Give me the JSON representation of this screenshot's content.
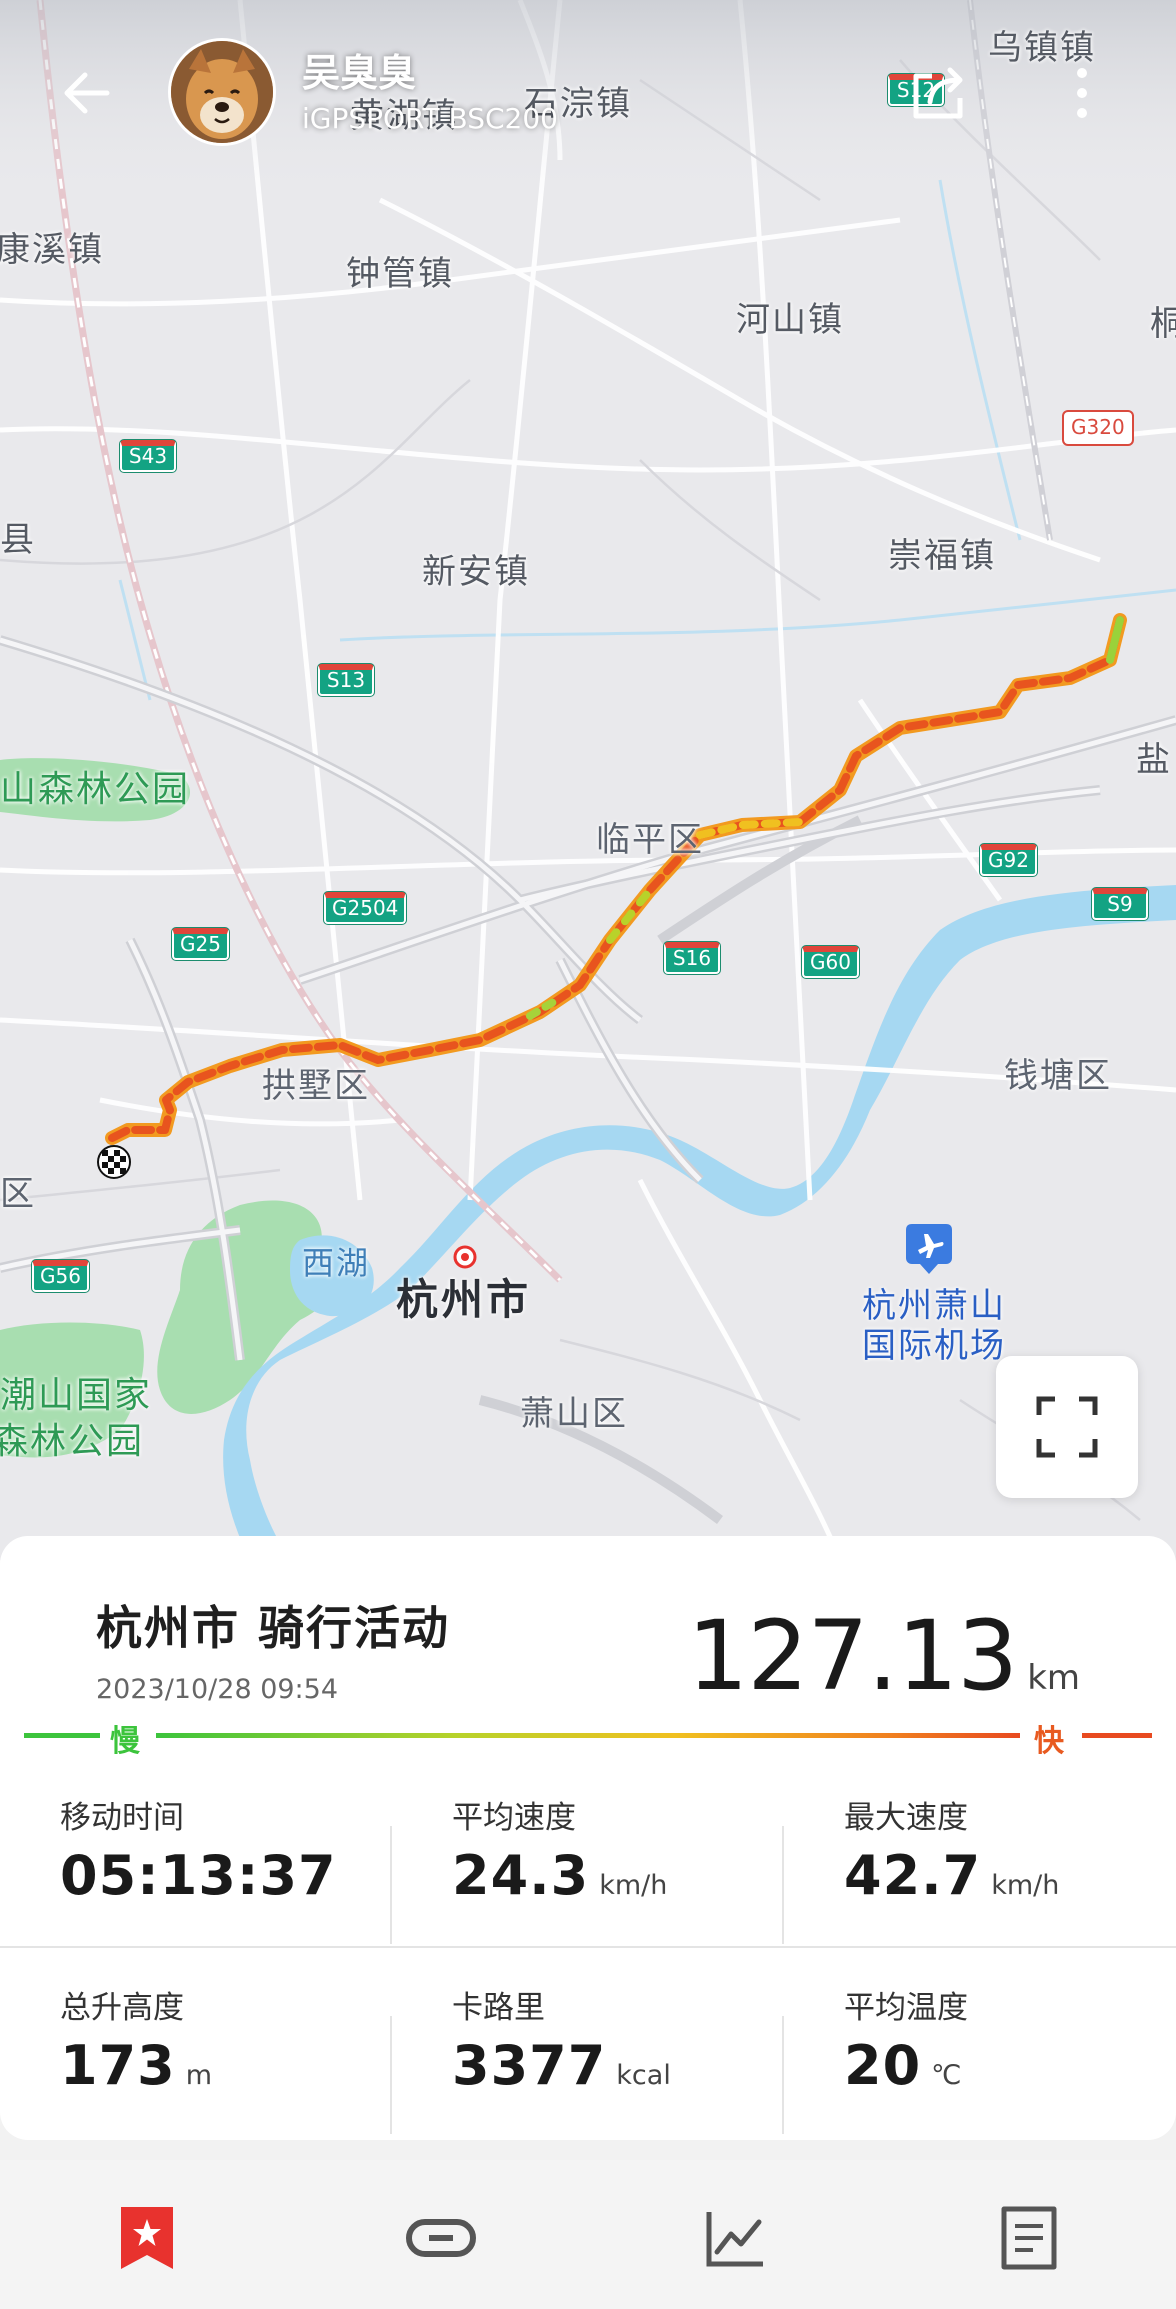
{
  "header": {
    "user_name": "吴臭臭",
    "device": "iGPSPORT BSC200"
  },
  "map": {
    "places": [
      {
        "id": "wuzhen",
        "label": "乌镇镇"
      },
      {
        "id": "huanghu",
        "label": "黄湖镇"
      },
      {
        "id": "shicong",
        "label": "石淙镇"
      },
      {
        "id": "dexi",
        "label": "康溪镇"
      },
      {
        "id": "zhongguan",
        "label": "钟管镇"
      },
      {
        "id": "heshan",
        "label": "河山镇"
      },
      {
        "id": "xinan",
        "label": "新安镇"
      },
      {
        "id": "chongfu",
        "label": "崇福镇"
      },
      {
        "id": "linping",
        "label": "临平区"
      },
      {
        "id": "gongshu",
        "label": "拱墅区"
      },
      {
        "id": "qiantang",
        "label": "钱塘区"
      },
      {
        "id": "xiaoshan",
        "label": "萧山区"
      },
      {
        "id": "hangzhou",
        "label": "杭州市"
      },
      {
        "id": "xihu",
        "label": "西湖"
      },
      {
        "id": "forest1",
        "label": "山森林公园"
      },
      {
        "id": "forest2a",
        "label": "潮山国家"
      },
      {
        "id": "forest2b",
        "label": "森林公园"
      },
      {
        "id": "airport_a",
        "label": "杭州萧山"
      },
      {
        "id": "airport_b",
        "label": "国际机场"
      },
      {
        "id": "edge_xian",
        "label": "县"
      },
      {
        "id": "edge_qu",
        "label": "区"
      },
      {
        "id": "edge_yan",
        "label": "盐"
      },
      {
        "id": "edge_tong",
        "label": "桐"
      }
    ],
    "roads": [
      "S12",
      "S43",
      "G320",
      "S13",
      "G2504",
      "G25",
      "S16",
      "G60",
      "G92",
      "S9",
      "G56"
    ]
  },
  "activity": {
    "title": "杭州市 骑行活动",
    "datetime": "2023/10/28 09:54",
    "distance": "127.13",
    "distance_unit": "km",
    "slow_label": "慢",
    "fast_label": "快"
  },
  "stats": [
    {
      "label": "移动时间",
      "value": "05:13:37",
      "unit": ""
    },
    {
      "label": "平均速度",
      "value": "24.3",
      "unit": "km/h"
    },
    {
      "label": "最大速度",
      "value": "42.7",
      "unit": "km/h"
    },
    {
      "label": "总升高度",
      "value": "173",
      "unit": "m"
    },
    {
      "label": "卡路里",
      "value": "3377",
      "unit": "kcal"
    },
    {
      "label": "平均温度",
      "value": "20",
      "unit": "℃"
    }
  ],
  "colors": {
    "accent": "#e8322e",
    "route_fast": "#e84a20",
    "route_slow": "#3cc43c",
    "river": "#a6d8f2",
    "park": "#a8deb0"
  },
  "nav": [
    {
      "icon": "bookmark-star-icon",
      "active": true
    },
    {
      "icon": "link-icon",
      "active": false
    },
    {
      "icon": "chart-icon",
      "active": false
    },
    {
      "icon": "document-icon",
      "active": false
    }
  ]
}
